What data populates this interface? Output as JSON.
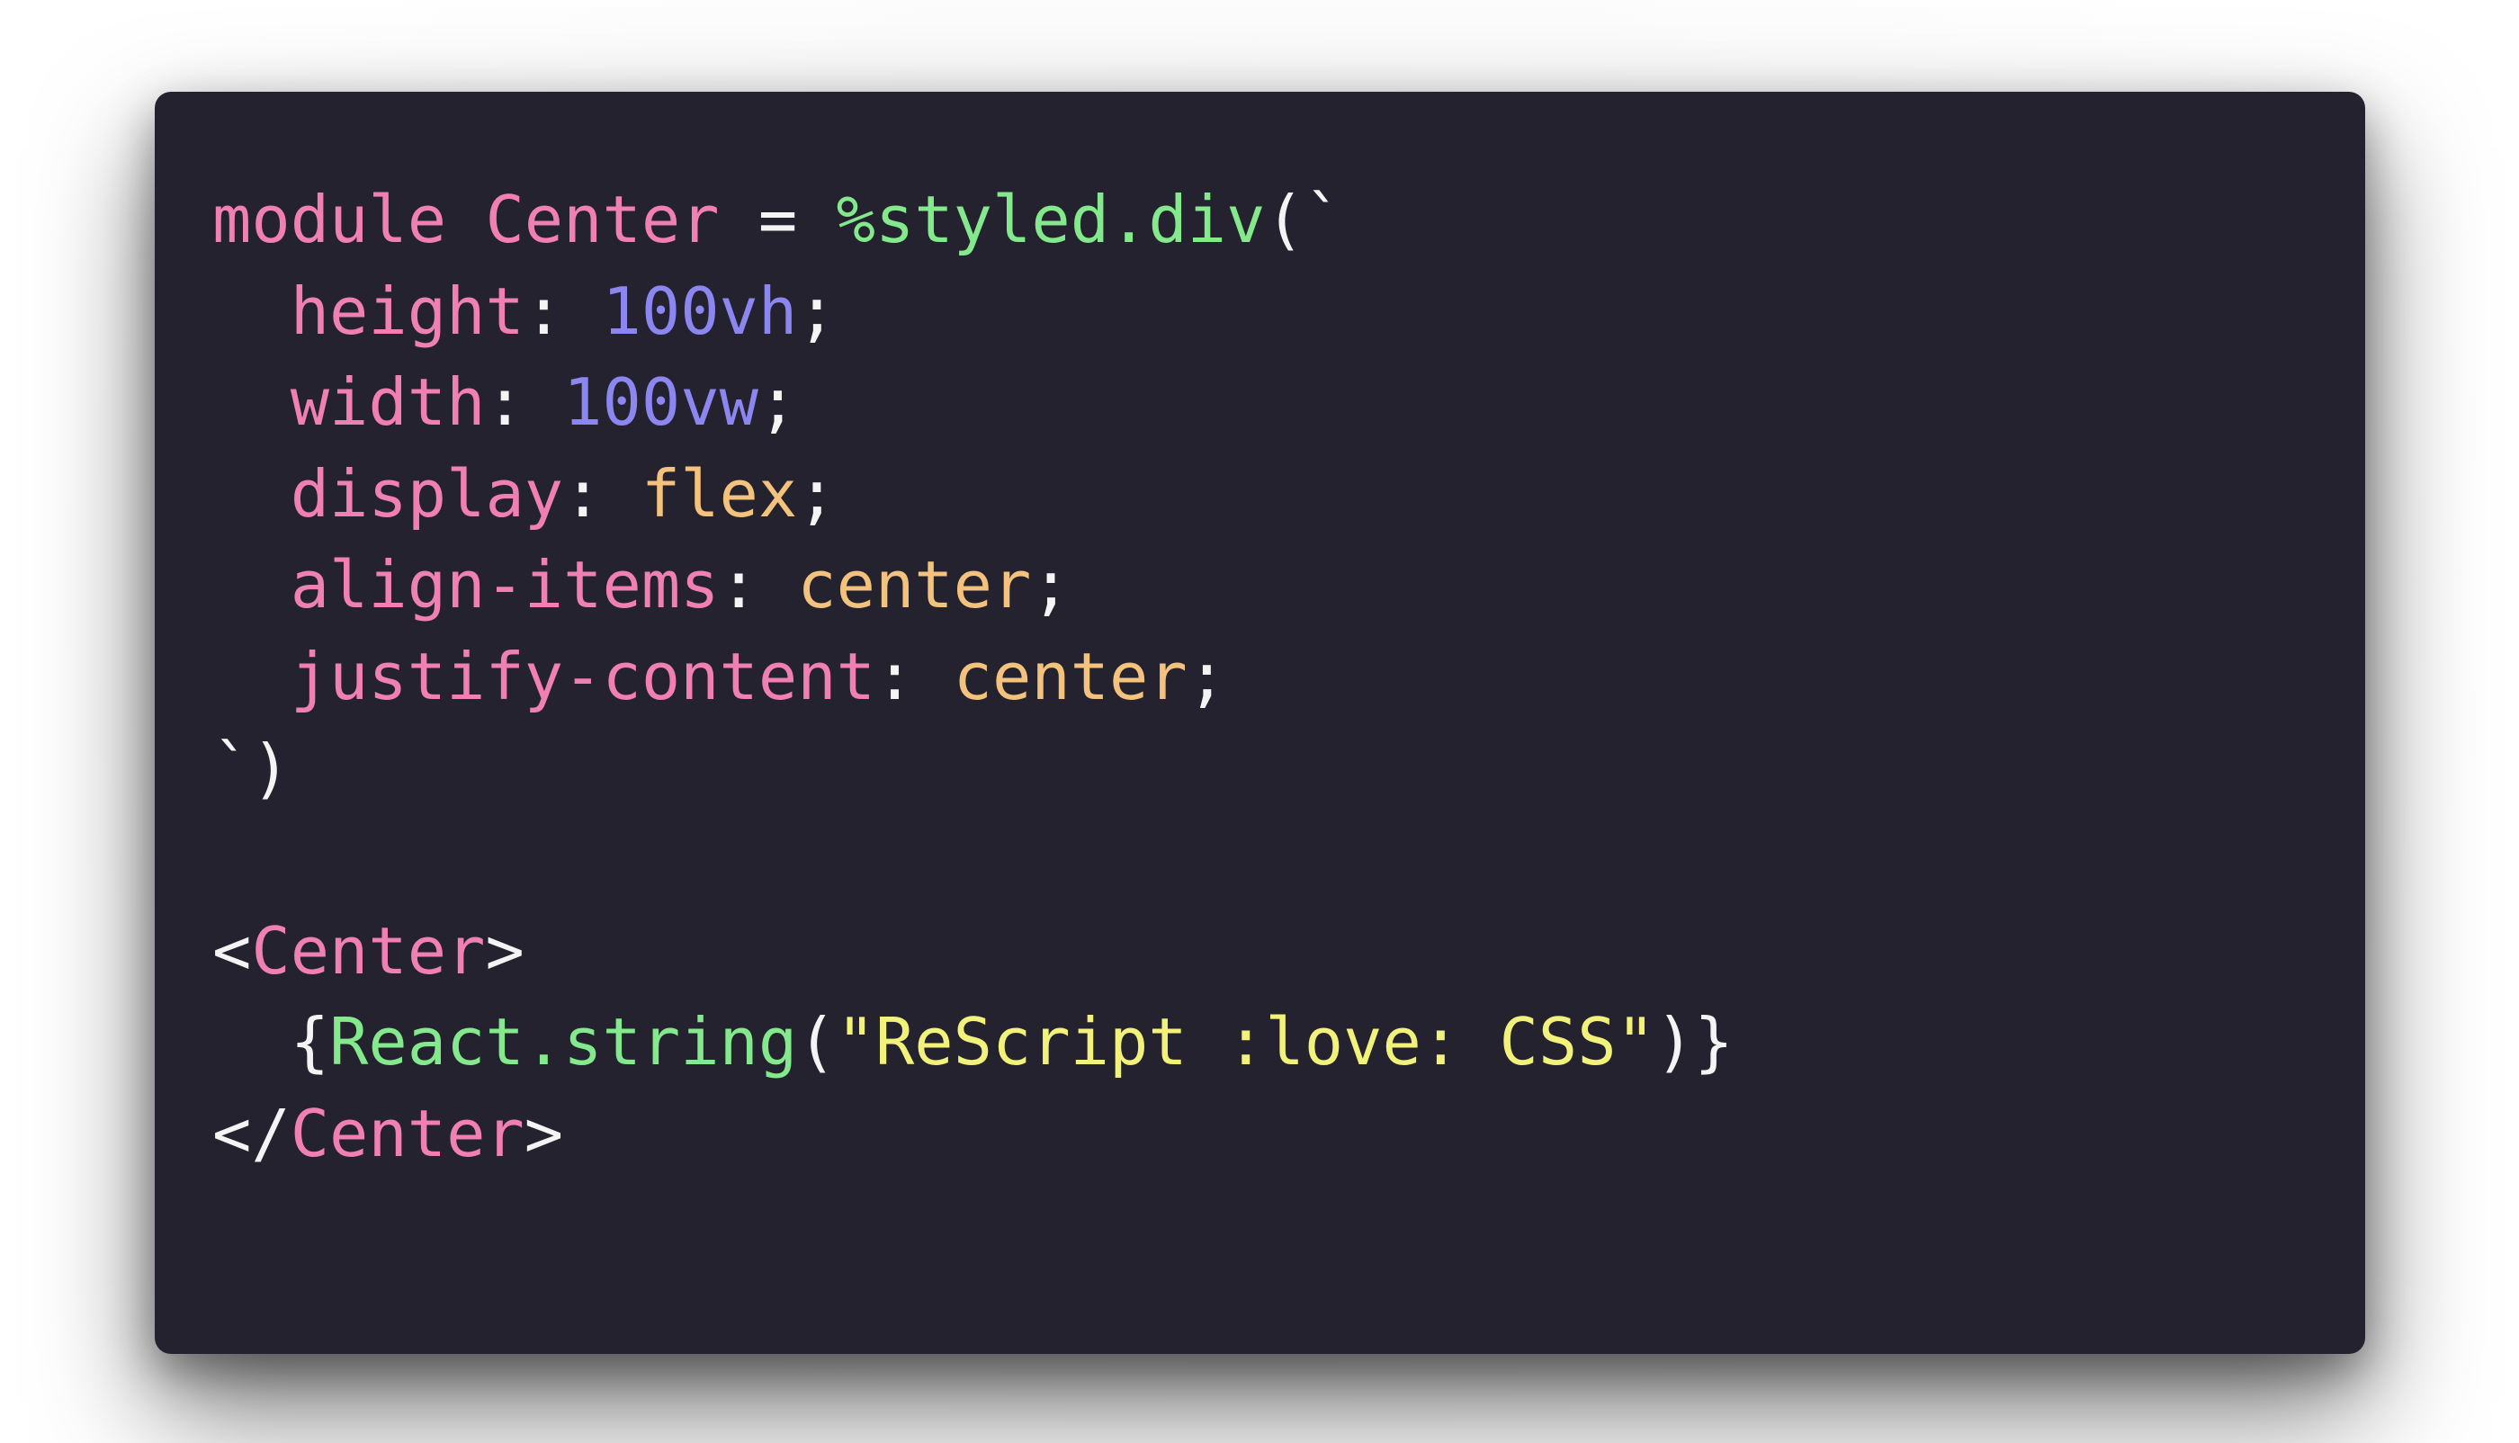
{
  "colors": {
    "background": "#ffffff",
    "panel": "#23222e",
    "keyword": "#f07fb4",
    "function": "#84e88c",
    "number": "#8c86f0",
    "value": "#f3c27d",
    "string": "#f2f27a",
    "plain": "#f4f4f4"
  },
  "code": {
    "line1": {
      "kw1": "module",
      "name": "Center",
      "eq": "=",
      "fn": "%styled.div",
      "open": "(`"
    },
    "line2": {
      "prop": "height",
      "colon": ":",
      "num": "100vh",
      "semi": ";"
    },
    "line3": {
      "prop": "width",
      "colon": ":",
      "num": "100vw",
      "semi": ";"
    },
    "line4": {
      "prop": "display",
      "colon": ":",
      "val": "flex",
      "semi": ";"
    },
    "line5": {
      "prop": "align-items",
      "colon": ":",
      "val": "center",
      "semi": ";"
    },
    "line6": {
      "prop": "justify-content",
      "colon": ":",
      "val": "center",
      "semi": ";"
    },
    "line7": {
      "close": "`)"
    },
    "line9": {
      "lt": "<",
      "tag": "Center",
      "gt": ">"
    },
    "line10": {
      "brace_open": "{",
      "fn": "React.string",
      "paren_open": "(",
      "str": "\"ReScript :love: CSS\"",
      "paren_close": ")",
      "brace_close": "}"
    },
    "line11": {
      "lt": "</",
      "tag": "Center",
      "gt": ">"
    }
  }
}
